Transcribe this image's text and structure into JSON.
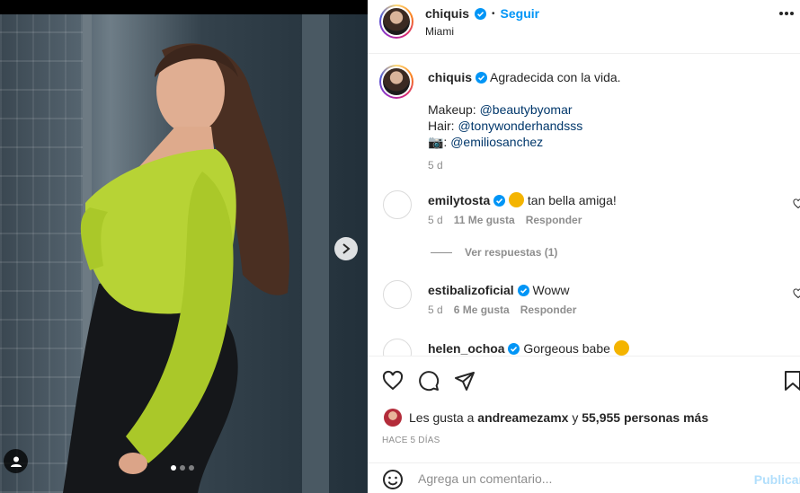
{
  "post": {
    "username": "chiquis",
    "follow_label": "Seguir",
    "separator": "•",
    "location": "Miami",
    "more_icon": "more-horizontal-icon"
  },
  "caption": {
    "username": "chiquis",
    "text": "Agradecida con la vida.",
    "makeup_label": "Makeup: ",
    "makeup_mention": "@beautybyomar",
    "hair_label": "Hair: ",
    "hair_mention": "@tonywonderhandsss",
    "camera_label": "📷: ",
    "camera_mention": "@emiliosanchez",
    "time": "5 d"
  },
  "comments": [
    {
      "username": "emilytosta",
      "text": "tan bella amiga!",
      "time": "5 d",
      "likes": "11 Me gusta",
      "reply": "Responder",
      "view_replies": "Ver respuestas (1)"
    },
    {
      "username": "estibalizoficial",
      "text": "Woww",
      "time": "5 d",
      "likes": "6 Me gusta",
      "reply": "Responder"
    },
    {
      "username": "helen_ochoa",
      "text": "Gorgeous babe"
    }
  ],
  "likes": {
    "prefix": "Les gusta a ",
    "user": "andreamezamx",
    "connector": " y ",
    "count": "55,955 personas más"
  },
  "posted_ago": "HACE 5 DÍAS",
  "comment_box": {
    "placeholder": "Agrega un comentario...",
    "publish_label": "Publicar"
  },
  "carousel": {
    "slides": 3,
    "active": 1
  },
  "colors": {
    "accent": "#0095f6",
    "verified": "#0095f6",
    "mention": "#00376b",
    "muted": "#8e8e8e"
  }
}
